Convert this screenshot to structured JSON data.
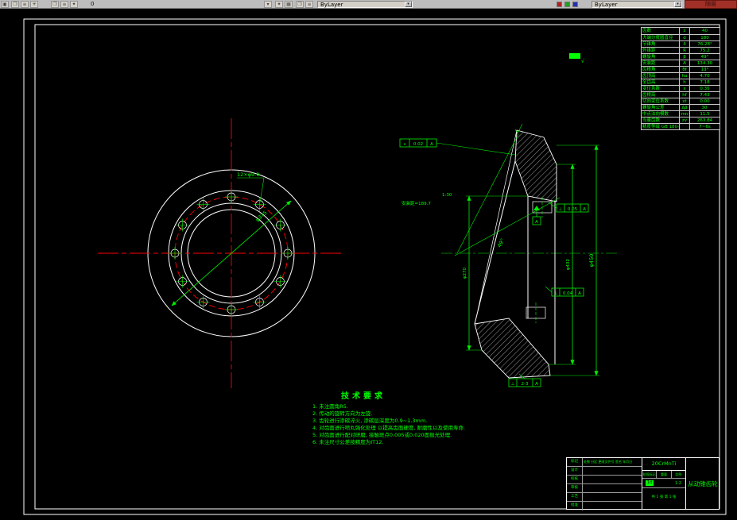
{
  "toolbar": {
    "color_combo": "ByLayer",
    "linetype_combo": "ByLayer",
    "right_button": "随层",
    "coord_text": "0",
    "icons": {
      "cube": "▣",
      "sheet": "❐",
      "layers": "≡",
      "sun": "✳",
      "dropdown": "▾",
      "bolt": "✦",
      "paint": "▦"
    }
  },
  "sheet": {
    "finish_mark": "√"
  },
  "front_view": {
    "holes_label": "12×φ9.9",
    "bolt_circle_dim": "φ375"
  },
  "section_view": {
    "overall_dim": "φ450",
    "hub_dim": "φ432",
    "bore_dim": "φ270",
    "pitch_angle": "49°",
    "mount_distance": "安装距=189.7",
    "taper_note": "1:30",
    "face_frame": {
      "sym": "⌖",
      "val": "0.02",
      "datum": "A"
    },
    "frame1": {
      "sym": "⊥",
      "val": "0.05",
      "datum": "A"
    },
    "frame2": {
      "sym": "⊥",
      "val": "0.04",
      "datum": "A"
    },
    "frame3": {
      "sym": "⊥",
      "val": "2-3",
      "datum": "A"
    },
    "datum_label": "A"
  },
  "param_table": {
    "rows": [
      {
        "label": "齿数",
        "sym": "z",
        "val": "40"
      },
      {
        "label": "大端分度圆直径",
        "sym": "d",
        "val": "180"
      },
      {
        "label": "节锥角",
        "sym": "δ",
        "val": "76.28°"
      },
      {
        "label": "外锥距",
        "sym": "R",
        "val": "75.2"
      },
      {
        "label": "螺旋角",
        "sym": "β",
        "val": "49°"
      },
      {
        "label": "安装距",
        "sym": "A",
        "val": "134.30"
      },
      {
        "label": "齿根角",
        "sym": "θf",
        "val": "13°"
      },
      {
        "label": "齿顶高",
        "sym": "ha",
        "val": "4.70"
      },
      {
        "label": "全齿高",
        "sym": "h",
        "val": "7.18"
      },
      {
        "label": "变位系数",
        "sym": "x",
        "val": "0.35"
      },
      {
        "label": "齿根高",
        "sym": "hf",
        "val": "7.43"
      },
      {
        "label": "切向变位系数",
        "sym": "xt",
        "val": "0.00"
      },
      {
        "label": "螺旋角公差",
        "sym": "Δβ",
        "val": "30′"
      },
      {
        "label": "中点法向模数",
        "sym": "mn",
        "val": "11.5"
      },
      {
        "label": "当量齿数",
        "sym": "zv",
        "val": "263.84"
      },
      {
        "label": "精度等级 GB 180-90",
        "sym": "",
        "val": "7~6s"
      }
    ]
  },
  "tech_requirements": {
    "title": "技术要求",
    "items": [
      "1. 未注圆角R5.",
      "2. 传动的旋转方向为左旋.",
      "3. 齿轮进行渗碳淬火, 渗碳层深度为0.9~1.3mm.",
      "4. 对齿面进行喷丸强化处理 以提高齿面硬度, 耐磨性以及使用寿命.",
      "5. 对齿面进行配对研磨, 接触斑点0.005或0.020面抛光处理.",
      "6. 未注尺寸公差按精度为IT12."
    ]
  },
  "title_block": {
    "material": "20CrMnTi",
    "part_name": "从动锥齿轮",
    "left_rows": [
      {
        "c1": "标记",
        "c2": "处数 分区 更改文件号 签名 年月日"
      },
      {
        "c1": "设计",
        "c2": ""
      },
      {
        "c1": "校核",
        "c2": ""
      },
      {
        "c1": "审核",
        "c2": ""
      },
      {
        "c1": "工艺",
        "c2": ""
      },
      {
        "c1": "批准",
        "c2": ""
      }
    ],
    "stage_label": "阶段标记",
    "weight_label": "重量",
    "scale_label": "比例",
    "scale_value": "1:2",
    "grade_chip": "1d",
    "sheet_info": "共 1 张  第 1 张"
  }
}
